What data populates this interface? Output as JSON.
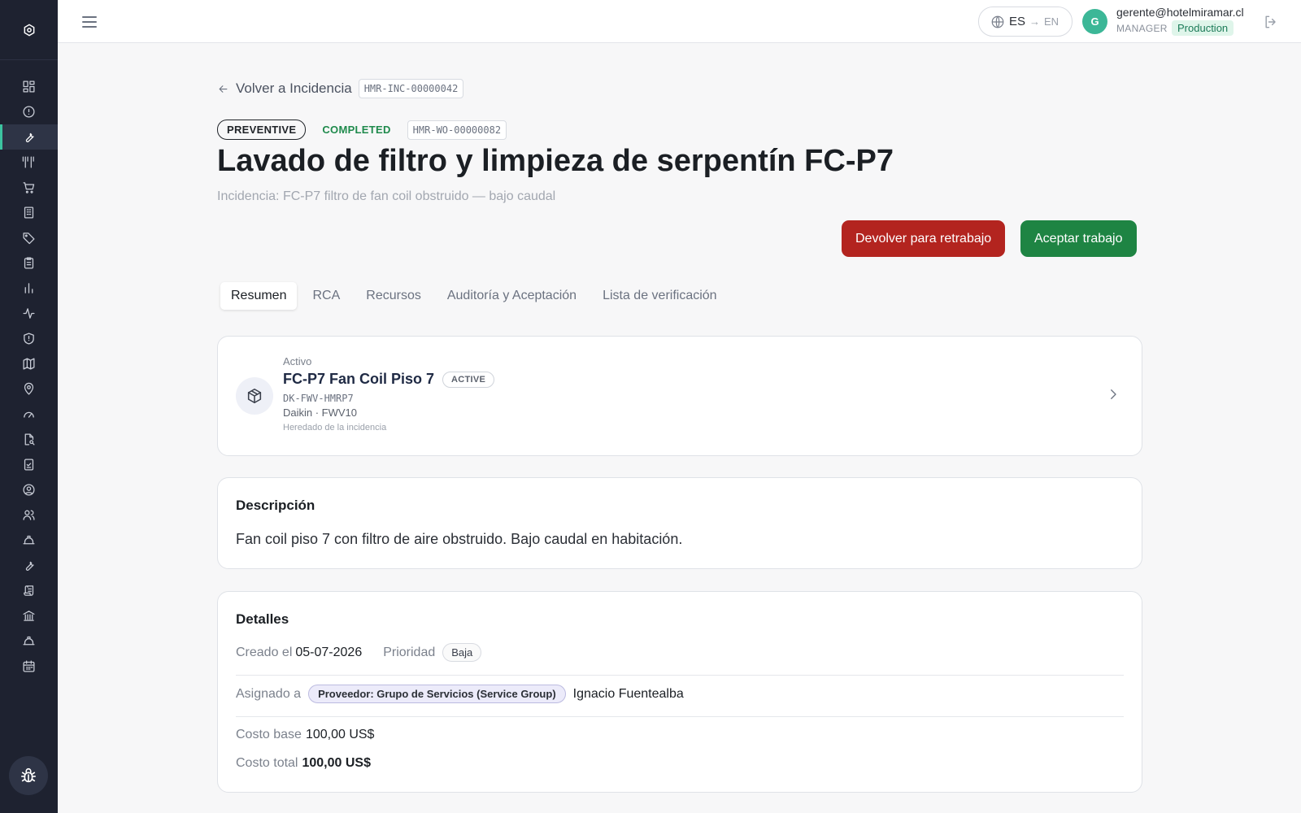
{
  "topbar": {
    "lang_current": "ES",
    "lang_arrow": "→",
    "lang_next": "EN",
    "avatar_initial": "G",
    "user_email": "gerente@hotelmiramar.cl",
    "user_role": "MANAGER",
    "environment": "Production"
  },
  "sidebar": {
    "active_item": "work-orders",
    "items": [
      "dashboard",
      "incidents",
      "work-orders",
      "utensils",
      "cart",
      "buildings",
      "tags",
      "clipboard",
      "charts",
      "activity",
      "shield",
      "map",
      "location",
      "gauge",
      "file-search",
      "checklist",
      "user-circle",
      "users",
      "hard-hat",
      "wrench",
      "scroll",
      "bank",
      "hard-hat-2",
      "calendar"
    ]
  },
  "breadcrumb": {
    "back_label": "Volver a Incidencia",
    "incident_code": "HMR-INC-00000042"
  },
  "work_order": {
    "type": "PREVENTIVE",
    "status": "COMPLETED",
    "code": "HMR-WO-00000082",
    "title": "Lavado de filtro y limpieza de serpentín FC-P7",
    "subtitle": "Incidencia: FC-P7 filtro de fan coil obstruido — bajo caudal"
  },
  "actions": {
    "return_label": "Devolver para retrabajo",
    "accept_label": "Aceptar trabajo"
  },
  "tabs": [
    {
      "label": "Resumen",
      "active": true
    },
    {
      "label": "RCA",
      "active": false
    },
    {
      "label": "Recursos",
      "active": false
    },
    {
      "label": "Auditoría y Aceptación",
      "active": false
    },
    {
      "label": "Lista de verificación",
      "active": false
    }
  ],
  "asset": {
    "kind_label": "Activo",
    "name": "FC-P7 Fan Coil Piso 7",
    "status": "ACTIVE",
    "code": "DK-FWV-HMRP7",
    "model": "Daikin · FWV10",
    "note": "Heredado de la incidencia"
  },
  "description": {
    "heading": "Descripción",
    "text": "Fan coil piso 7 con filtro de aire obstruido. Bajo caudal en habitación."
  },
  "details": {
    "heading": "Detalles",
    "created_label": "Creado el",
    "created_value": "05-07-2026",
    "priority_label": "Prioridad",
    "priority_value": "Baja",
    "assigned_label": "Asignado a",
    "vendor_badge": "Proveedor: Grupo de Servicios (Service Group)",
    "assignee": "Ignacio Fuentealba",
    "base_cost_label": "Costo base",
    "base_cost_value": "100,00 US$",
    "total_cost_label": "Costo total",
    "total_cost_value": "100,00 US$"
  },
  "colors": {
    "sidebar_bg": "#1e2230",
    "accent": "#3cc3a0",
    "danger": "#b3241f",
    "success": "#1e8443"
  }
}
